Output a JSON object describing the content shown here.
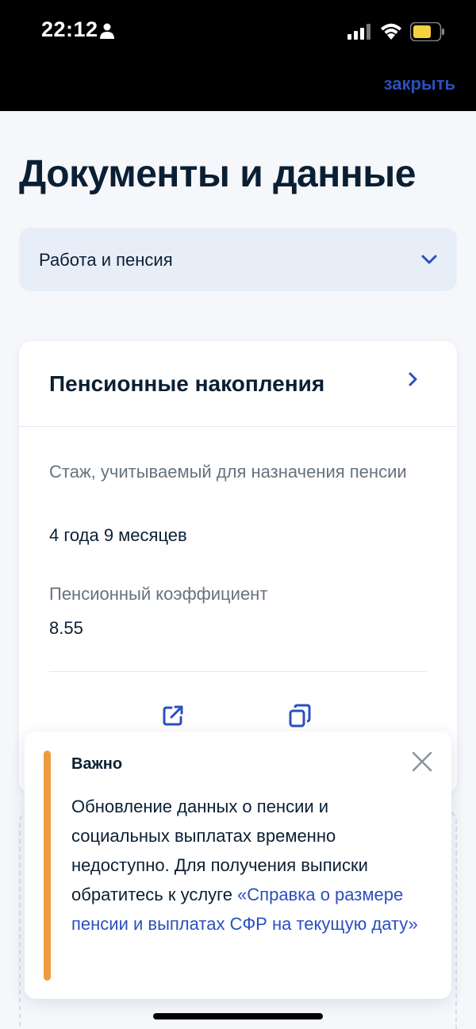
{
  "status_bar": {
    "time": "22:12",
    "icons": [
      "person-icon",
      "signal-icon",
      "wifi-icon",
      "battery-icon"
    ]
  },
  "header": {
    "close_label": "закрыть"
  },
  "page": {
    "title": "Документы и данные"
  },
  "category_select": {
    "value": "Работа и пенсия"
  },
  "card": {
    "title": "Пенсионные накопления",
    "fields": [
      {
        "label": "Стаж, учитываемый для назначения пенсии",
        "value": "4 года 9 месяцев"
      },
      {
        "label": "Пенсионный коэффициент",
        "value": "8.55"
      }
    ],
    "actions": [
      "open-external-icon",
      "copy-icon"
    ]
  },
  "notice": {
    "title": "Важно",
    "text": "Обновление данных о пенсии и социальных выплатах временно недоступно. Для получения выписки обратитесь к услуге ",
    "link": "«Справка о размере пенсии и выплатах СФР на текущую дату»"
  },
  "colors": {
    "accent": "#2b4fbf",
    "warning": "#ee9b3f",
    "text": "#0b1f33",
    "muted": "#66727f",
    "background": "#f5f7fb"
  }
}
